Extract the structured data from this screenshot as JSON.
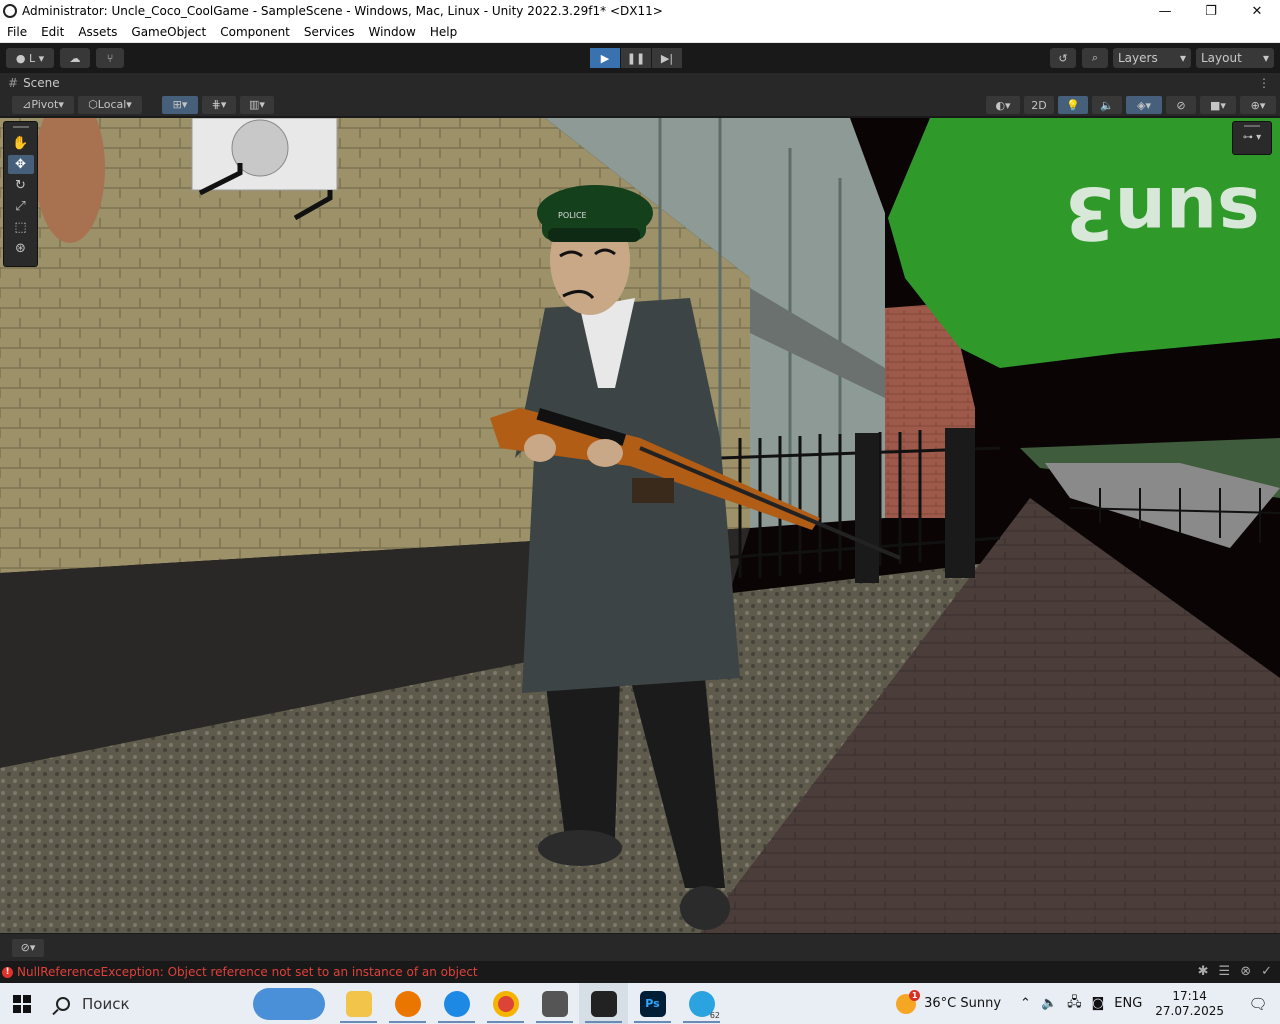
{
  "window": {
    "title": "Administrator: Uncle_Coco_CoolGame - SampleScene - Windows, Mac, Linux - Unity 2022.3.29f1* <DX11>",
    "minimize": "—",
    "maximize": "❐",
    "close": "✕"
  },
  "menu": [
    "File",
    "Edit",
    "Assets",
    "GameObject",
    "Component",
    "Services",
    "Window",
    "Help"
  ],
  "toolbar": {
    "account_label": "L",
    "layers_label": "Layers",
    "layout_label": "Layout"
  },
  "scene_tab": {
    "label": "Scene"
  },
  "scene_toolbar": {
    "pivot_label": "Pivot",
    "local_label": "Local",
    "mode_2d_label": "2D"
  },
  "viewport": {
    "sign_text": "sun3",
    "cap_text": "POLICE"
  },
  "console": {
    "error_message": "NullReferenceException: Object reference not set to an instance of an object"
  },
  "taskbar": {
    "search_placeholder": "Поиск",
    "telegram_badge": "62",
    "weather_temp": "36°C",
    "weather_desc": "Sunny",
    "weather_alert": "1",
    "lang": "ENG",
    "time": "17:14",
    "date": "27.07.2025"
  },
  "colors": {
    "editor_bg": "#191919",
    "panel_bg": "#282828",
    "accent_blue": "#3a72b0",
    "error_red": "#e0413b"
  }
}
